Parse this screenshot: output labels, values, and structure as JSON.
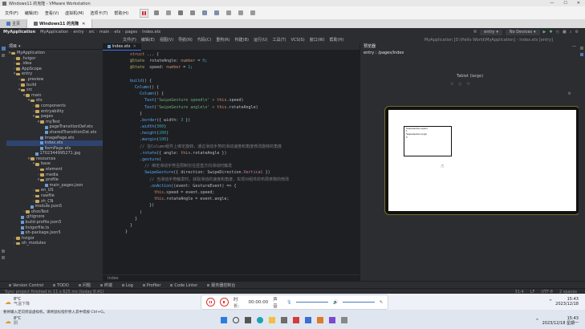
{
  "vm": {
    "title": "Windows11 的克隆 - VMware Workstation",
    "menu": [
      "文件(F)",
      "编辑(E)",
      "查看(V)",
      "虚拟机(M)",
      "选项卡(T)",
      "帮助(H)"
    ],
    "tabs": [
      {
        "label": "主页"
      },
      {
        "label": "Windows11 的克隆"
      }
    ]
  },
  "ide": {
    "project_name": "MyApplication",
    "breadcrumb": [
      "MyApplication",
      "entry",
      "src",
      "main",
      "ets",
      "pages",
      "Index.ets"
    ],
    "menu": [
      "文件(F)",
      "编辑(E)",
      "视图(V)",
      "导航(N)",
      "代码(C)",
      "重构(R)",
      "构建(B)",
      "运行(U)",
      "工具(T)",
      "VCS(S)",
      "窗口(W)",
      "帮助(H)"
    ],
    "window_title": "MyApplication [D:\\Hello World\\MyApplication] - Index.ets [entry]",
    "run_config": "entry",
    "device": "No Devices",
    "project_panel_label": "项目",
    "tree": [
      {
        "depth": 0,
        "type": "folder",
        "label": "MyApplication",
        "expanded": true
      },
      {
        "depth": 1,
        "type": "folder",
        "label": ".hvigor"
      },
      {
        "depth": 1,
        "type": "folder",
        "label": ".idea"
      },
      {
        "depth": 1,
        "type": "folder",
        "label": "AppScope"
      },
      {
        "depth": 1,
        "type": "folder",
        "label": "entry",
        "expanded": true
      },
      {
        "depth": 2,
        "type": "folder",
        "label": ".preview"
      },
      {
        "depth": 2,
        "type": "folder",
        "label": "build"
      },
      {
        "depth": 2,
        "type": "folder",
        "label": "src",
        "expanded": true
      },
      {
        "depth": 3,
        "type": "folder",
        "label": "main",
        "expanded": true
      },
      {
        "depth": 4,
        "type": "folder",
        "label": "ets",
        "expanded": true
      },
      {
        "depth": 5,
        "type": "folder",
        "label": "components"
      },
      {
        "depth": 5,
        "type": "folder",
        "label": "entryability"
      },
      {
        "depth": 5,
        "type": "folder",
        "label": "pages",
        "expanded": true
      },
      {
        "depth": 6,
        "type": "folder",
        "label": "myTest",
        "expanded": true
      },
      {
        "depth": 7,
        "type": "file",
        "label": "pageTransitionDef.ets"
      },
      {
        "depth": 7,
        "type": "file",
        "label": "sharedTransitionDst.ets"
      },
      {
        "depth": 6,
        "type": "file",
        "label": "ImagePage.ets"
      },
      {
        "depth": 6,
        "type": "file",
        "label": "Index.ets"
      },
      {
        "depth": 6,
        "type": "file",
        "label": "ItemPage.ets"
      },
      {
        "depth": 5,
        "type": "file",
        "label": "1702344995271.jpg"
      },
      {
        "depth": 4,
        "type": "folder",
        "label": "resources",
        "expanded": true
      },
      {
        "depth": 5,
        "type": "folder",
        "label": "base",
        "expanded": true
      },
      {
        "depth": 6,
        "type": "folder",
        "label": "element"
      },
      {
        "depth": 6,
        "type": "folder",
        "label": "media"
      },
      {
        "depth": 6,
        "type": "folder",
        "label": "profile",
        "expanded": true
      },
      {
        "depth": 7,
        "type": "file",
        "label": "main_pages.json"
      },
      {
        "depth": 5,
        "type": "folder",
        "label": "en_US"
      },
      {
        "depth": 5,
        "type": "folder",
        "label": "rawfile"
      },
      {
        "depth": 5,
        "type": "folder",
        "label": "zh_CN"
      },
      {
        "depth": 4,
        "type": "file",
        "label": "module.json5"
      },
      {
        "depth": 3,
        "type": "folder",
        "label": "ohosTest"
      },
      {
        "depth": 2,
        "type": "file",
        "label": ".gitignore"
      },
      {
        "depth": 2,
        "type": "file",
        "label": "build-profile.json5"
      },
      {
        "depth": 2,
        "type": "file",
        "label": "hvigorfile.ts"
      },
      {
        "depth": 2,
        "type": "file",
        "label": "oh-package.json5"
      },
      {
        "depth": 1,
        "type": "folder",
        "label": "hvigor"
      },
      {
        "depth": 1,
        "type": "folder",
        "label": "oh_modules"
      }
    ],
    "editor_tab": "Index.ets",
    "footer_crumb": "Index",
    "code": [
      {
        "n": "",
        "t": [
          [
            "",
            "  "
          ],
          [
            "kw",
            "struct"
          ],
          [
            "",
            " ... {"
          ]
        ]
      },
      {
        "n": "",
        "t": [
          [
            "dec",
            "  @State "
          ],
          [
            "",
            " rotateAngle: "
          ],
          [
            "kw",
            "number"
          ],
          [
            "",
            " = "
          ],
          [
            "num",
            "0"
          ],
          [
            "",
            ";"
          ]
        ]
      },
      {
        "n": "",
        "t": [
          [
            "dec",
            "  @State "
          ],
          [
            "",
            " speed: "
          ],
          [
            "kw",
            "number"
          ],
          [
            "",
            " = "
          ],
          [
            "num",
            "1"
          ],
          [
            "",
            ";"
          ]
        ]
      },
      {
        "n": "",
        "t": [
          [
            "",
            ""
          ]
        ]
      },
      {
        "n": "",
        "t": [
          [
            "fn",
            "  build"
          ],
          [
            "",
            "() {"
          ]
        ]
      },
      {
        "n": "",
        "t": [
          [
            "fn",
            "    Column"
          ],
          [
            "",
            "() {"
          ]
        ]
      },
      {
        "n": "",
        "t": [
          [
            "fn",
            "      Column"
          ],
          [
            "",
            "() {"
          ]
        ]
      },
      {
        "n": "",
        "t": [
          [
            "fn",
            "        Text"
          ],
          [
            "",
            "("
          ],
          [
            "str",
            "'SwipeGesture speed\\n' + "
          ],
          [
            "kw",
            "this"
          ],
          [
            "",
            ".speed)"
          ]
        ]
      },
      {
        "n": "",
        "t": [
          [
            "fn",
            "        Text"
          ],
          [
            "",
            "("
          ],
          [
            "str",
            "'SwipeGesture angle\\n' + "
          ],
          [
            "kw",
            "this"
          ],
          [
            "",
            ".rotateAngle)"
          ]
        ]
      },
      {
        "n": "",
        "t": [
          [
            "",
            "      }"
          ]
        ]
      },
      {
        "n": "",
        "t": [
          [
            "",
            "      ."
          ],
          [
            "fn",
            "border"
          ],
          [
            "",
            "({ width: "
          ],
          [
            "num",
            "3"
          ],
          [
            "",
            " })"
          ]
        ]
      },
      {
        "n": "",
        "t": [
          [
            "",
            "      ."
          ],
          [
            "fn",
            "width"
          ],
          [
            "",
            "("
          ],
          [
            "num",
            "300"
          ],
          [
            "",
            ")"
          ]
        ]
      },
      {
        "n": "",
        "t": [
          [
            "",
            "      ."
          ],
          [
            "fn",
            "height"
          ],
          [
            "",
            "("
          ],
          [
            "num",
            "200"
          ],
          [
            "",
            ")"
          ]
        ]
      },
      {
        "n": "",
        "t": [
          [
            "",
            "      ."
          ],
          [
            "fn",
            "margin"
          ],
          [
            "",
            "("
          ],
          [
            "num",
            "100"
          ],
          [
            "",
            ")"
          ]
        ]
      },
      {
        "n": "",
        "t": [
          [
            "cm",
            "      // 在Column组件上绑定旋转，通过滑动手势的滑动速度和角度修改旋转的角度"
          ]
        ]
      },
      {
        "n": "",
        "t": [
          [
            "",
            "      ."
          ],
          [
            "fn",
            "rotate"
          ],
          [
            "",
            "({ angle: "
          ],
          [
            "kw",
            "this"
          ],
          [
            "",
            ".rotateAngle })"
          ]
        ]
      },
      {
        "n": "",
        "t": [
          [
            "",
            "      ."
          ],
          [
            "fn",
            "gesture"
          ],
          [
            "",
            "("
          ]
        ]
      },
      {
        "n": "",
        "t": [
          [
            "cm",
            "        // 绑定滑动手势且限制仅在竖直方向滑动时触发"
          ]
        ]
      },
      {
        "n": "",
        "t": [
          [
            "fn",
            "        SwipeGesture"
          ],
          [
            "",
            "({ direction: SwipeDirection."
          ],
          [
            "prop",
            "Vertical"
          ],
          [
            "",
            " })"
          ]
        ]
      },
      {
        "n": "",
        "t": [
          [
            "cm",
            "          // 当滑动手势触发时，获取滑动的速度和角度，实现对组件的布局参数的修改"
          ]
        ]
      },
      {
        "n": "",
        "t": [
          [
            "",
            "          ."
          ],
          [
            "fn",
            "onAction"
          ],
          [
            "",
            "((event: GestureEvent) => {"
          ]
        ]
      },
      {
        "n": "",
        "t": [
          [
            "kw",
            "            this"
          ],
          [
            "",
            ".speed = event.speed;"
          ]
        ]
      },
      {
        "n": "",
        "t": [
          [
            "kw",
            "            this"
          ],
          [
            "",
            ".rotateAngle = event.angle;"
          ]
        ]
      },
      {
        "n": "",
        "t": [
          [
            "",
            "          })"
          ]
        ]
      },
      {
        "n": "",
        "t": [
          [
            "",
            "      )"
          ]
        ]
      },
      {
        "n": "",
        "t": [
          [
            "",
            "    }"
          ]
        ]
      },
      {
        "n": "",
        "t": [
          [
            "",
            "  }"
          ]
        ]
      },
      {
        "n": "",
        "t": [
          [
            "",
            "}"
          ]
        ]
      }
    ],
    "previewer": {
      "panel_label": "预览器",
      "path": "entry : /pages/Index",
      "device_label": "Tablet (large)",
      "box_line1": "SwipeGesture speed",
      "box_line1b": "1",
      "box_line2": "SwipeGesture angle",
      "box_line2b": "0"
    },
    "bottom_tabs": [
      "Version Control",
      "TODO",
      "问题",
      "终端",
      "Log",
      "Profiler",
      "Code Linter",
      "服务器控制台"
    ],
    "status_left": "Sync project finished in 11 s 625 ms (today 8:41)",
    "status_right": [
      "31:4",
      "LF",
      "UTF-8",
      "2 spaces"
    ]
  },
  "recording": {
    "time_label": "时长:",
    "time_value": "00:00:00",
    "sound_label": "声音"
  },
  "guest_taskbar": {
    "weather_temp": "8°C",
    "weather_desc": "气温下降",
    "time": "15:43",
    "date": "2023/12/18"
  },
  "host_taskbar": {
    "hint": "要将输入定向到该虚拟机，请将鼠标指针移入其中或按 Ctrl+G。",
    "weather_temp": "8°C",
    "weather_desc": "阴",
    "time": "15:43",
    "date": "2023/12/18 星期一"
  }
}
